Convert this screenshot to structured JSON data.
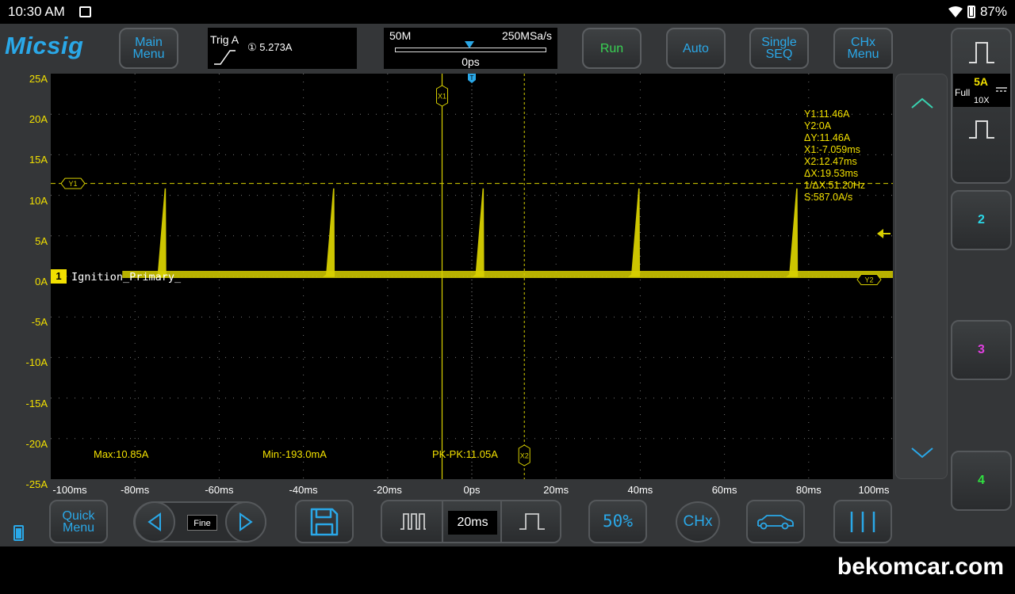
{
  "status_bar": {
    "time": "10:30 AM",
    "battery": "87%"
  },
  "app": {
    "logo": "Micsig"
  },
  "toolbar": {
    "main_menu": "Main Menu",
    "trigger_title": "Trig A",
    "trigger_value": "① 5.273A",
    "memory_depth": "50M",
    "sample_rate": "250MSa/s",
    "horizontal_position": "0ps",
    "run": "Run",
    "auto": "Auto",
    "single_seq": "Single SEQ",
    "chx_menu": "CHx Menu"
  },
  "channel_panel": {
    "ch1_scale": "5A",
    "ch1_bw": "Full",
    "ch1_probe": "10X",
    "ch2_label": "2",
    "ch3_label": "3",
    "ch4_label": "4",
    "ch2_color": "#2ad8e8",
    "ch3_color": "#e040e0",
    "ch4_color": "#30e040"
  },
  "waveform": {
    "channel_number": "1",
    "channel_name": "Ignition_Primary_",
    "trace_color": "#d8d000",
    "y_cursor_label_1": "Y1",
    "y_cursor_label_2": "Y2",
    "x_cursor_label_1": "X1",
    "x_cursor_label_2": "X2",
    "trigger_marker": "T",
    "y_axis_ticks": [
      "25A",
      "20A",
      "15A",
      "10A",
      "5A",
      "0A",
      "-5A",
      "-10A",
      "-15A",
      "-20A",
      "-25A"
    ],
    "x_axis_ticks": [
      "-100ms",
      "-80ms",
      "-60ms",
      "-40ms",
      "-20ms",
      "0ps",
      "20ms",
      "40ms",
      "60ms",
      "80ms",
      "100ms"
    ]
  },
  "chart_data": {
    "type": "line",
    "xlim": [
      -100,
      100
    ],
    "ylim": [
      -25,
      25
    ],
    "x_unit": "ms",
    "y_unit": "A",
    "series": [
      {
        "name": "Ignition_Primary_",
        "x": [
          -75,
          -74.5,
          -72.8,
          -72.7,
          -35,
          -34.5,
          -32.8,
          -32.7,
          0.5,
          1.0,
          2.7,
          2.8,
          37.5,
          38.0,
          39.7,
          39.8,
          75.0,
          75.5,
          77.2,
          77.3
        ],
        "peak_A": 10.85
      }
    ],
    "grid": true
  },
  "measurements": {
    "y1": "Y1:11.46A",
    "y2": "Y2:0A",
    "dy": "ΔY:11.46A",
    "x1": "X1:-7.059ms",
    "x2": "X2:12.47ms",
    "dx": "ΔX:19.53ms",
    "inv_dx": "1/ΔX:51.20Hz",
    "slope": "S:587.0A/s",
    "max": "Max:10.85A",
    "min": "Min:-193.0mA",
    "pkpk": "PK-PK:11.05A"
  },
  "bottom_bar": {
    "quick_menu": "Quick Menu",
    "fine": "Fine",
    "timebase": "20ms",
    "fifty_percent": "50%",
    "chx": "CHx"
  },
  "watermark": "bekomcar.com"
}
